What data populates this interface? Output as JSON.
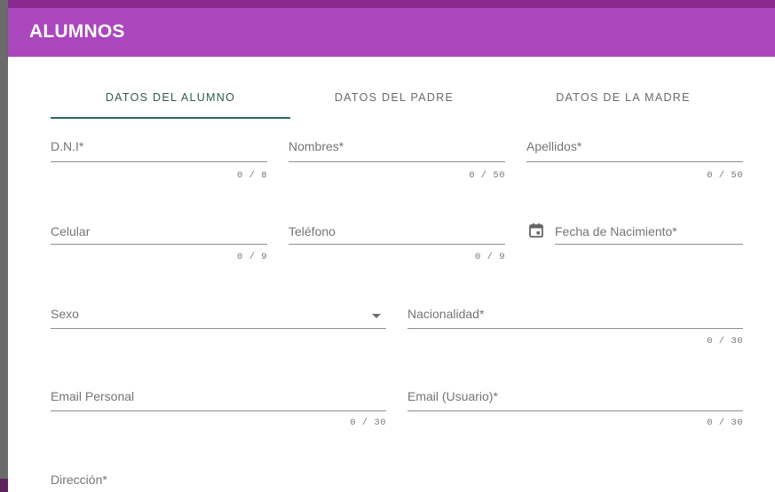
{
  "header": {
    "title": "ALUMNOS"
  },
  "tabs": [
    {
      "label": "DATOS DEL ALUMNO",
      "active": true
    },
    {
      "label": "DATOS DEL PADRE",
      "active": false
    },
    {
      "label": "DATOS DE LA MADRE",
      "active": false
    }
  ],
  "fields": {
    "dni": {
      "label": "D.N.I*",
      "counter": "0 / 8"
    },
    "nombres": {
      "label": "Nombres*",
      "counter": "0 / 50"
    },
    "apellidos": {
      "label": "Apellidos*",
      "counter": "0 / 50"
    },
    "celular": {
      "label": "Celular",
      "counter": "0 / 9"
    },
    "telefono": {
      "label": "Teléfono",
      "counter": "0 / 9"
    },
    "fecha": {
      "label": "Fecha de Nacimiento*",
      "icon": "calendar-icon"
    },
    "sexo": {
      "label": "Sexo",
      "icon": "dropdown-arrow-icon"
    },
    "nacionalidad": {
      "label": "Nacionalidad*",
      "counter": "0 / 30"
    },
    "email_personal": {
      "label": "Email Personal",
      "counter": "0 / 30"
    },
    "email_usuario": {
      "label": "Email (Usuario)*",
      "counter": "0 / 30"
    },
    "direccion": {
      "label": "Dirección*"
    }
  },
  "colors": {
    "header": "#ab47bc",
    "tab_active": "#2f6b50",
    "frame": "#8a2a8f"
  }
}
